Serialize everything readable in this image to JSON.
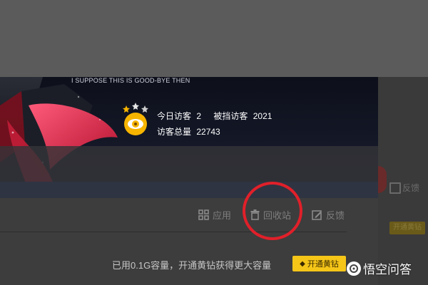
{
  "banner": {
    "tagline": "I SUPPOSE THIS IS GOOD-BYE THEN"
  },
  "stats": {
    "today_visitors_label": "今日访客",
    "today_visitors_value": "2",
    "blocked_visitors_label": "被挡访客",
    "blocked_visitors_value": "2021",
    "total_visitors_label": "访客总量",
    "total_visitors_value": "22743"
  },
  "toolbar": {
    "apps_label": "应用",
    "recycle_label": "回收站",
    "feedback_label": "反馈"
  },
  "storage": {
    "text": "已用0.1G容量，开通黄钻获得更大容量",
    "upgrade_label": "开通黄钻"
  },
  "right_strip": {
    "feedback_label": "反馈",
    "upgrade_label": "开通黄钻"
  },
  "watermark": {
    "text": "悟空问答"
  },
  "colors": {
    "accent_yellow": "#f5c518",
    "highlight_red": "#e0202a",
    "badge_orange": "#f7b500"
  },
  "icons": {
    "apps": "grid-icon",
    "recycle": "trash-icon",
    "feedback": "edit-icon",
    "badge": "eye-badge-icon"
  }
}
